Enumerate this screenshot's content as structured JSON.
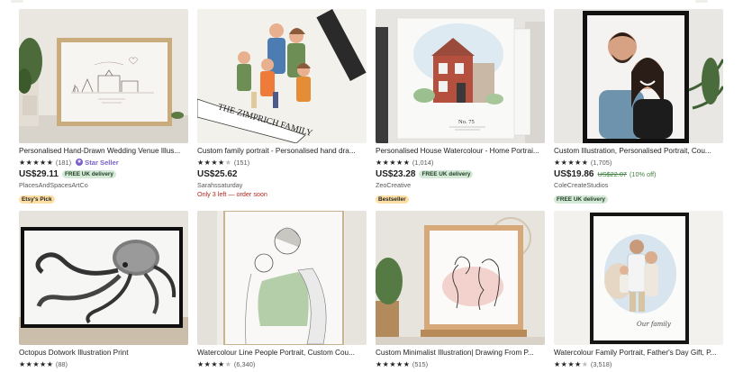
{
  "listings": [
    {
      "title": "Personalised Hand-Drawn Wedding Venue Illus...",
      "rating": 5,
      "reviews": "(181)",
      "star_seller": "Star Seller",
      "price": "US$29.11",
      "delivery": "FREE UK delivery",
      "seller": "PlacesAndSpacesArtCo",
      "tag": "Etsy's Pick"
    },
    {
      "title": "Custom family portrait - Personalised hand dra...",
      "rating": 4.5,
      "reviews": "(151)",
      "price": "US$25.62",
      "seller": "Sarahssaturday",
      "stock_note": "Only 3 left — order soon"
    },
    {
      "title": "Personalised House Watercolour - Home Portrai...",
      "rating": 5,
      "reviews": "(1,014)",
      "price": "US$23.28",
      "delivery": "FREE UK delivery",
      "seller": "ZeoCreative",
      "tag": "Bestseller"
    },
    {
      "title": "Custom Illustration, Personalised Portrait, Cou...",
      "rating": 5,
      "reviews": "(1,705)",
      "price": "US$19.86",
      "original_price": "US$22.07",
      "discount": "(10% off)",
      "seller": "ColeCreateStudios",
      "tag": "FREE UK delivery"
    },
    {
      "title": "Octopus Dotwork Illustration Print",
      "rating": 5,
      "reviews": "(88)"
    },
    {
      "title": "Watercolour Line People Portrait, Custom Cou...",
      "rating": 4.5,
      "reviews": "(6,340)"
    },
    {
      "title": "Custom Minimalist Illustration| Drawing From P...",
      "rating": 5,
      "reviews": "(515)"
    },
    {
      "title": "Watercolour Family Portrait, Father's Day Gift, P...",
      "rating": 4.5,
      "reviews": "(3,518)"
    }
  ],
  "image_text": {
    "house_number": "No. 75",
    "family_banner": "THE ZIMPRICH FAMILY",
    "watercolour_family_caption": "Our family"
  },
  "colors": {
    "star_seller": "#7961c9",
    "free_delivery_bg": "#d4e9d7",
    "stock_warning": "#b3261e",
    "bestseller_bg": "#fddfa5"
  }
}
